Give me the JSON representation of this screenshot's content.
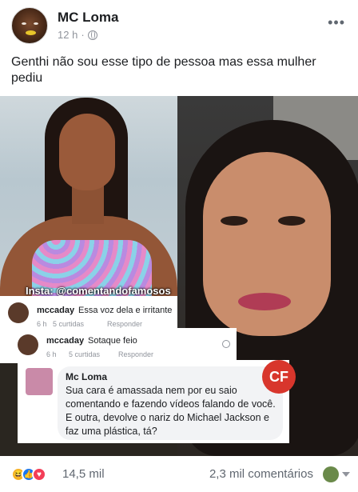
{
  "post": {
    "author": "MC Loma",
    "time": "12 h",
    "separator": "·",
    "text": "Genthi não sou esse tipo de pessoa mas essa mulher pediu",
    "more_icon": "more-horizontal-icon"
  },
  "image": {
    "watermark": "Insta: @comentandofamosos",
    "logo_text": "CF",
    "comments": [
      {
        "user": "mccaday",
        "text": "Essa voz dela e irritante",
        "age": "6 h",
        "likes": "5 curtidas",
        "reply": "Responder"
      },
      {
        "user": "mccaday",
        "text": "Sotaque feio",
        "age": "6 h",
        "likes": "5 curtidas",
        "reply": "Responder"
      },
      {
        "user": "Mc Loma",
        "text": "Sua cara é amassada nem por eu saio comentando e fazendo vídeos falando de você. E outra, devolve o nariz do Michael Jackson e faz uma plástica, tá?"
      }
    ]
  },
  "footer": {
    "reaction_count": "14,5 mil",
    "comment_count": "2,3 mil comentários"
  },
  "colors": {
    "meta_gray": "#90949c",
    "like_blue": "#1877f2",
    "love_red": "#f33e58",
    "haha_yellow": "#f7b125"
  }
}
